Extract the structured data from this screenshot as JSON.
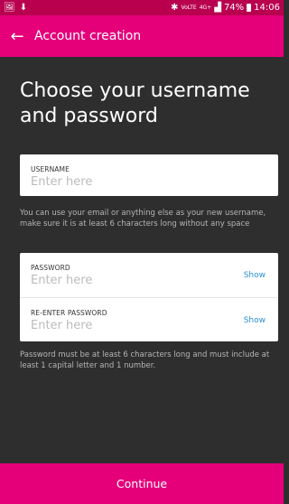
{
  "statusbar": {
    "network_top": "VoLTE",
    "network_small": "4G+",
    "battery": "74%",
    "time": "14:06"
  },
  "appbar": {
    "title": "Account creation"
  },
  "main": {
    "heading": "Choose your username and password",
    "username": {
      "label": "USERNAME",
      "placeholder": "Enter here",
      "helper": "You can use your email or anything else as your new username, make sure it is at least 6 characters long without any space"
    },
    "password": {
      "label": "PASSWORD",
      "placeholder": "Enter here",
      "show_label": "Show"
    },
    "reenter_password": {
      "label": "RE-ENTER PASSWORD",
      "placeholder": "Enter here",
      "show_label": "Show"
    },
    "password_helper": "Password must be at least 6 characters long and must include at least 1 capital letter and 1 number."
  },
  "footer": {
    "continue_label": "Continue"
  }
}
